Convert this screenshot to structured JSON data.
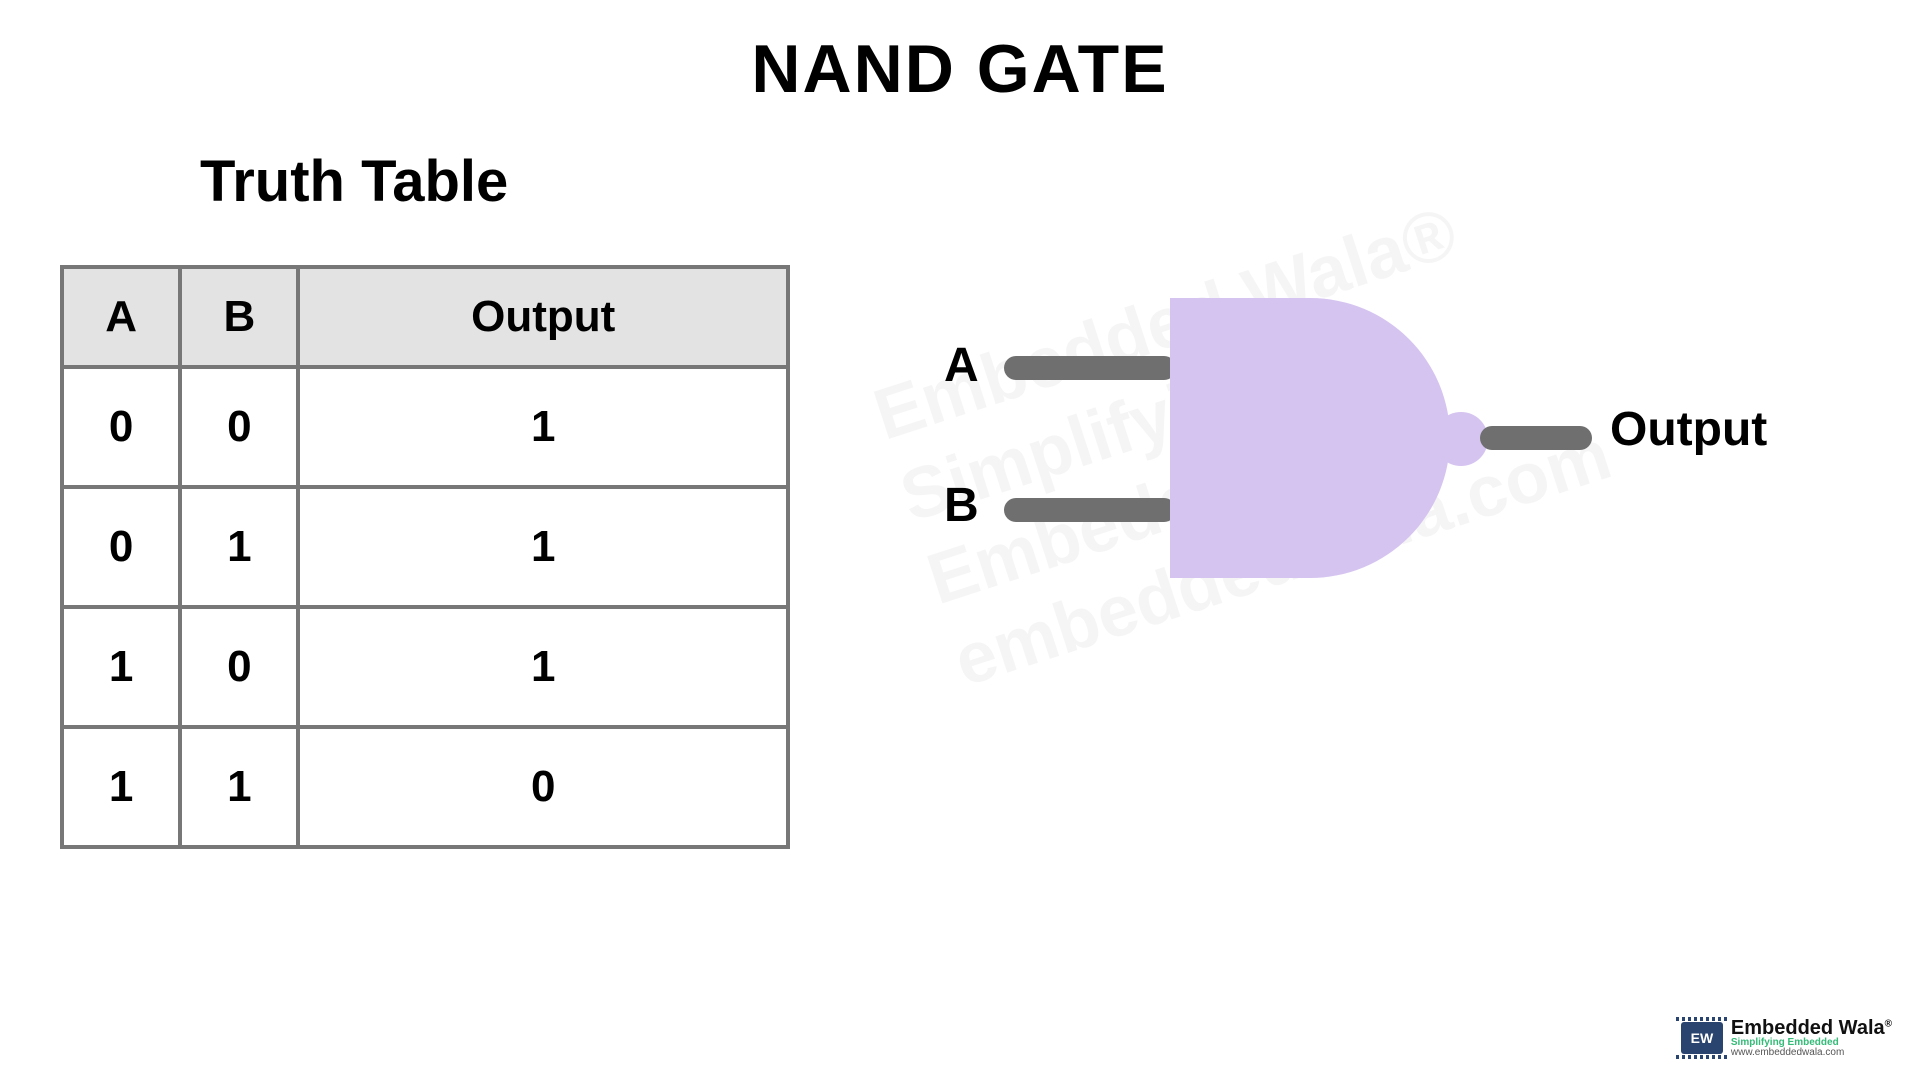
{
  "title": "NAND GATE",
  "table": {
    "heading": "Truth Table",
    "headers": [
      "A",
      "B",
      "Output"
    ],
    "rows": [
      [
        "0",
        "0",
        "1"
      ],
      [
        "0",
        "1",
        "1"
      ],
      [
        "1",
        "0",
        "1"
      ],
      [
        "1",
        "1",
        "0"
      ]
    ]
  },
  "gate": {
    "input_a": "A",
    "input_b": "B",
    "output": "Output"
  },
  "watermark": {
    "line1": "Embedded Wala®",
    "line2": "Simplifying Embedded",
    "line3": "embeddedwala.com"
  },
  "logo": {
    "badge": "EW",
    "name": "Embedded Wala",
    "reg": "®",
    "tagline": "Simplifying Embedded",
    "url": "www.embeddedwala.com"
  },
  "colors": {
    "gate_fill": "#d5c4f0",
    "wire": "#6f6f6f",
    "border": "#777"
  }
}
